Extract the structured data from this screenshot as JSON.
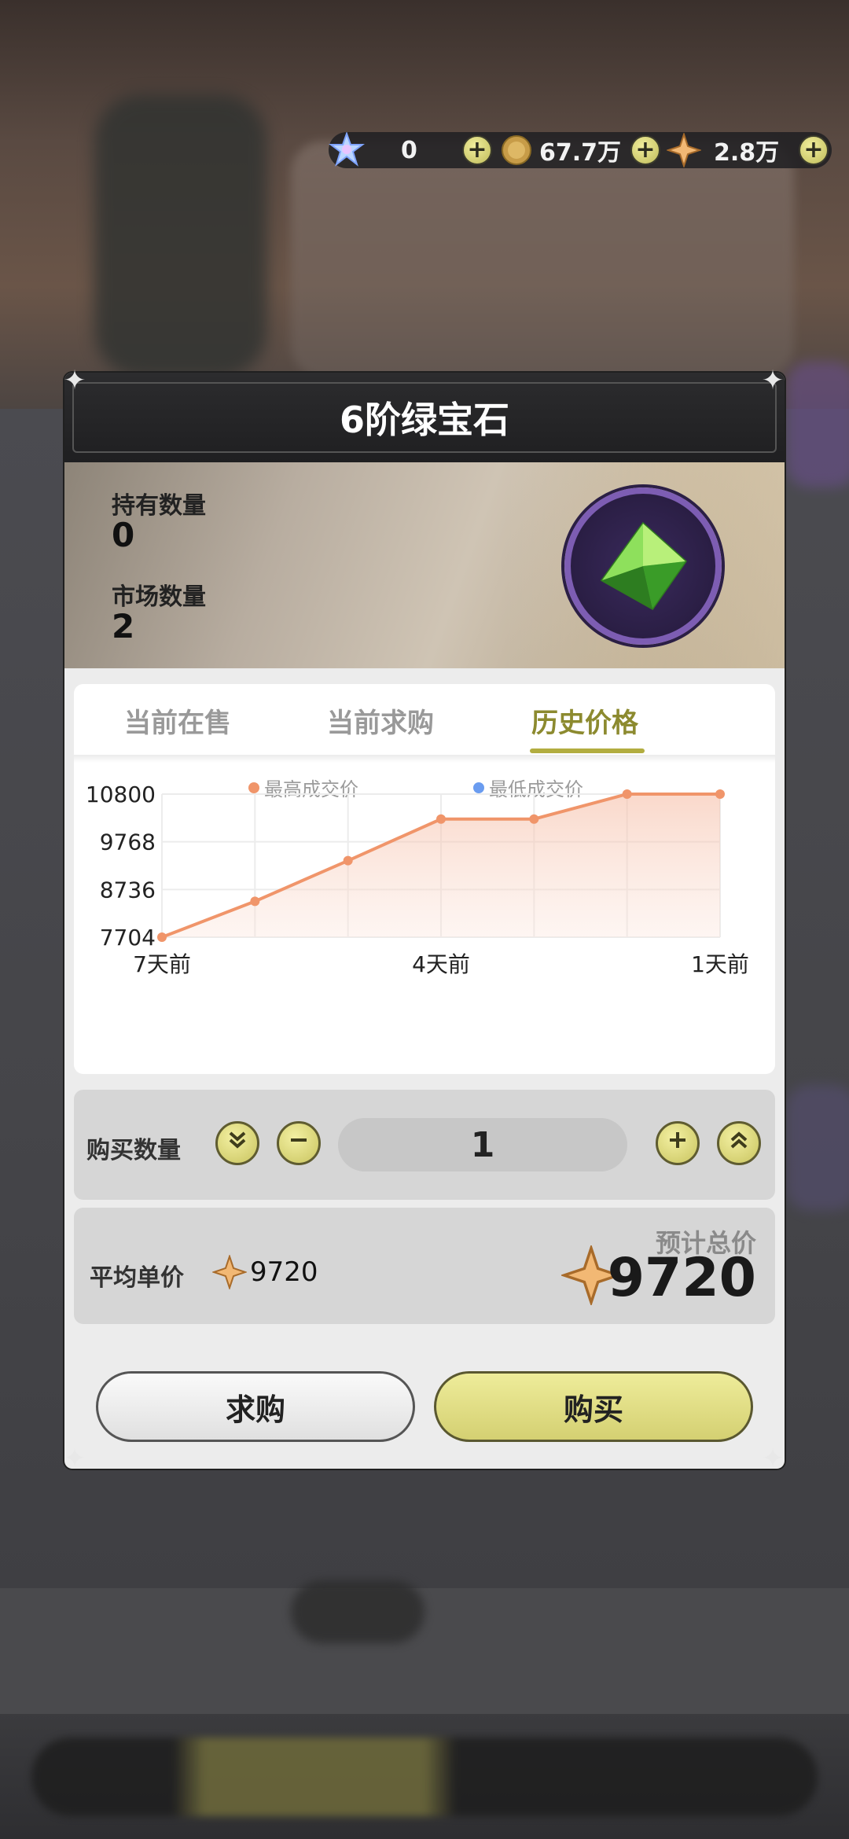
{
  "currencies": [
    {
      "name": "crystal",
      "value": "0",
      "icon": "crystal-star-icon"
    },
    {
      "name": "gold",
      "value": "67.7万",
      "icon": "gold-coin-icon"
    },
    {
      "name": "star",
      "value": "2.8万",
      "icon": "amber-star-icon"
    }
  ],
  "dialog": {
    "title": "6阶绿宝石",
    "held_label": "持有数量",
    "held_value": "0",
    "market_label": "市场数量",
    "market_value": "2",
    "item_icon": "green-gem-icon"
  },
  "tabs": [
    {
      "label": "当前在售",
      "active": false
    },
    {
      "label": "当前求购",
      "active": false
    },
    {
      "label": "历史价格",
      "active": true
    }
  ],
  "chart_data": {
    "type": "line",
    "legend": [
      "最高成交价",
      "最低成交价"
    ],
    "legend_colors": [
      "#f0956a",
      "#6a9cf0"
    ],
    "x_tick_labels": [
      "7天前",
      "4天前",
      "1天前"
    ],
    "y_tick_labels": [
      "10800",
      "9768",
      "8736",
      "7704"
    ],
    "ylim": [
      7704,
      10800
    ],
    "grid": true,
    "series": [
      {
        "name": "最高成交价",
        "x": [
          7,
          6,
          5,
          4,
          3,
          2,
          1
        ],
        "values": [
          7704,
          8480,
          9360,
          10260,
          10260,
          10800,
          10800
        ]
      }
    ]
  },
  "purchase": {
    "qty_label": "购买数量",
    "qty_value": "1",
    "avg_label": "平均单价",
    "avg_value": "9720",
    "total_label": "预计总价",
    "total_value": "9720"
  },
  "buttons": {
    "request": "求购",
    "buy": "购买"
  },
  "colors": {
    "accent": "#b2ad40",
    "line": "#f0956a",
    "area": "#f9d9cb"
  }
}
